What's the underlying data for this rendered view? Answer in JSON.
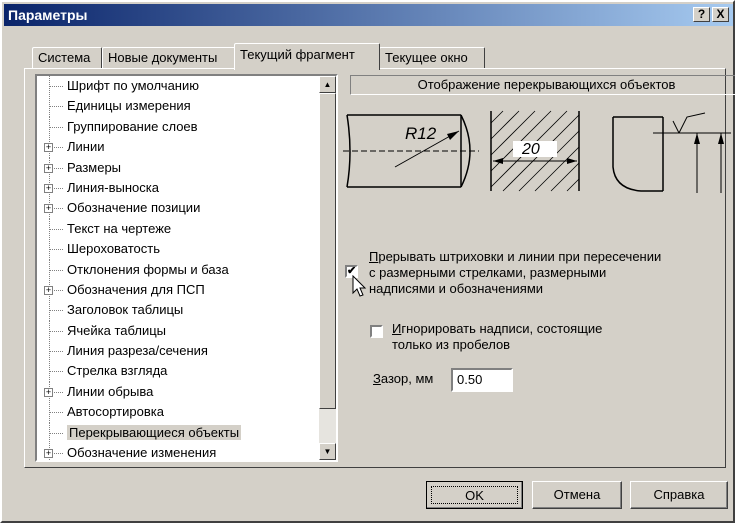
{
  "window": {
    "title": "Параметры",
    "help_btn": "?",
    "close_btn": "X"
  },
  "tabs": [
    "Система",
    "Новые документы",
    "Текущий фрагмент",
    "Текущее окно"
  ],
  "active_tab": "Текущий фрагмент",
  "tree": {
    "items": [
      {
        "label": "Шрифт по умолчанию",
        "expandable": false
      },
      {
        "label": "Единицы измерения",
        "expandable": false
      },
      {
        "label": "Группирование слоев",
        "expandable": false
      },
      {
        "label": "Линии",
        "expandable": true
      },
      {
        "label": "Размеры",
        "expandable": true
      },
      {
        "label": "Линия-выноска",
        "expandable": true
      },
      {
        "label": "Обозначение позиции",
        "expandable": true
      },
      {
        "label": "Текст на чертеже",
        "expandable": false
      },
      {
        "label": "Шероховатость",
        "expandable": false
      },
      {
        "label": "Отклонения формы и база",
        "expandable": false
      },
      {
        "label": "Обозначения для ПСП",
        "expandable": true
      },
      {
        "label": "Заголовок таблицы",
        "expandable": false
      },
      {
        "label": "Ячейка таблицы",
        "expandable": false
      },
      {
        "label": "Линия разреза/сечения",
        "expandable": false
      },
      {
        "label": "Стрелка взгляда",
        "expandable": false
      },
      {
        "label": "Линии обрыва",
        "expandable": true
      },
      {
        "label": "Автосортировка",
        "expandable": false
      },
      {
        "label": "Перекрывающиеся объекты",
        "expandable": false,
        "selected": true
      },
      {
        "label": "Обозначение изменения",
        "expandable": true
      }
    ]
  },
  "section": {
    "title": "Отображение перекрывающихся объектов",
    "illustration": {
      "radius_label": "R12",
      "dimension_label": "20"
    },
    "interrupt_checkbox": {
      "checked": true,
      "accel": "П",
      "lines": [
        "рерывать штриховки и линии при пересечении",
        "с размерными стрелками, размерными",
        "надписями и обозначениями"
      ]
    },
    "ignore_checkbox": {
      "checked": false,
      "accel": "И",
      "lines": [
        "гнорировать надписи, состоящие",
        "только из пробелов"
      ]
    },
    "gap": {
      "accel": "З",
      "label": "азор, мм",
      "value": "0.50"
    }
  },
  "buttons": {
    "ok": "OK",
    "cancel": "Отмена",
    "help": "Справка"
  }
}
